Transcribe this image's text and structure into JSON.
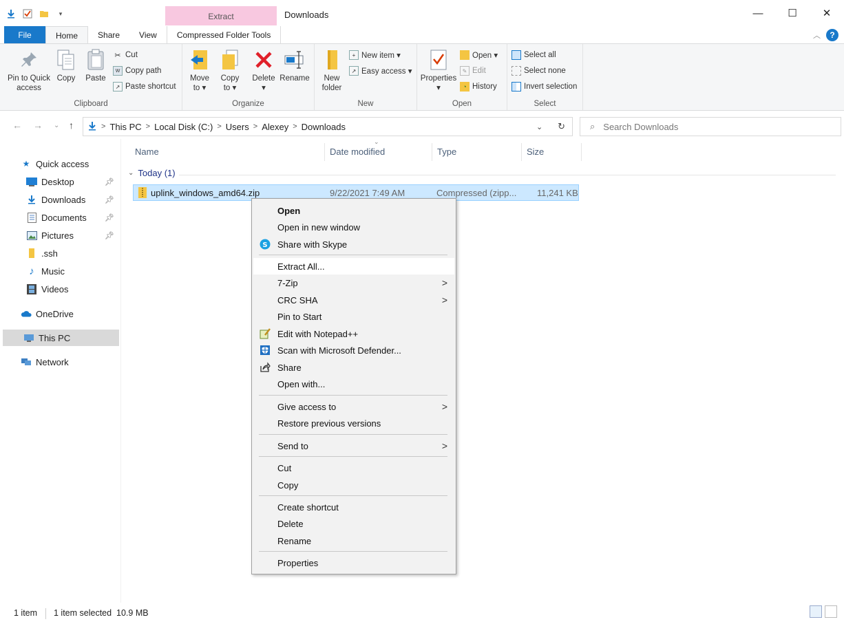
{
  "titlebar": {
    "context_tab": "Extract",
    "title": "Downloads",
    "minimize": "—",
    "maximize": "☐",
    "close": "✕"
  },
  "ribbon_tabs": {
    "file": "File",
    "home": "Home",
    "share": "Share",
    "view": "View",
    "compressed": "Compressed Folder Tools"
  },
  "ribbon": {
    "clipboard": {
      "label": "Clipboard",
      "pin": "Pin to Quick access",
      "pin_l1": "Pin to Quick",
      "pin_l2": "access",
      "copy": "Copy",
      "paste": "Paste",
      "cut": "Cut",
      "copy_path": "Copy path",
      "paste_shortcut": "Paste shortcut"
    },
    "organize": {
      "label": "Organize",
      "move_l1": "Move",
      "move_l2": "to ▾",
      "copy_l1": "Copy",
      "copy_l2": "to ▾",
      "delete": "Delete",
      "delete_arrow": "▾",
      "rename": "Rename"
    },
    "new": {
      "label": "New",
      "folder_l1": "New",
      "folder_l2": "folder",
      "new_item": "New item ▾",
      "easy_access": "Easy access ▾"
    },
    "open": {
      "label": "Open",
      "properties": "Properties",
      "properties_arrow": "▾",
      "open": "Open ▾",
      "edit": "Edit",
      "history": "History"
    },
    "select": {
      "label": "Select",
      "select_all": "Select all",
      "select_none": "Select none",
      "invert": "Invert selection"
    }
  },
  "address": {
    "crumbs": [
      "This PC",
      "Local Disk (C:)",
      "Users",
      "Alexey",
      "Downloads"
    ],
    "search_placeholder": "Search Downloads"
  },
  "nav": {
    "quick_access": "Quick access",
    "desktop": "Desktop",
    "downloads": "Downloads",
    "documents": "Documents",
    "pictures": "Pictures",
    "ssh": ".ssh",
    "music": "Music",
    "videos": "Videos",
    "onedrive": "OneDrive",
    "this_pc": "This PC",
    "network": "Network"
  },
  "columns": {
    "name": "Name",
    "date": "Date modified",
    "type": "Type",
    "size": "Size"
  },
  "group": {
    "label": "Today (1)"
  },
  "file": {
    "name": "uplink_windows_amd64.zip",
    "date": "9/22/2021 7:49 AM",
    "type": "Compressed (zipp...",
    "size": "11,241 KB"
  },
  "context_menu": {
    "open": "Open",
    "open_new_window": "Open in new window",
    "share_skype": "Share with Skype",
    "extract_all": "Extract All...",
    "seven_zip": "7-Zip",
    "crc_sha": "CRC SHA",
    "pin_start": "Pin to Start",
    "edit_notepad": "Edit with Notepad++",
    "scan_defender": "Scan with Microsoft Defender...",
    "share": "Share",
    "open_with": "Open with...",
    "give_access": "Give access to",
    "restore_versions": "Restore previous versions",
    "send_to": "Send to",
    "cut": "Cut",
    "copy": "Copy",
    "create_shortcut": "Create shortcut",
    "delete": "Delete",
    "rename": "Rename",
    "properties": "Properties"
  },
  "status": {
    "items": "1 item",
    "selected": "1 item selected  10.9 MB"
  },
  "colors": {
    "accent": "#1979ca",
    "selection": "#cce8ff",
    "context_header": "#f8c8e0"
  }
}
